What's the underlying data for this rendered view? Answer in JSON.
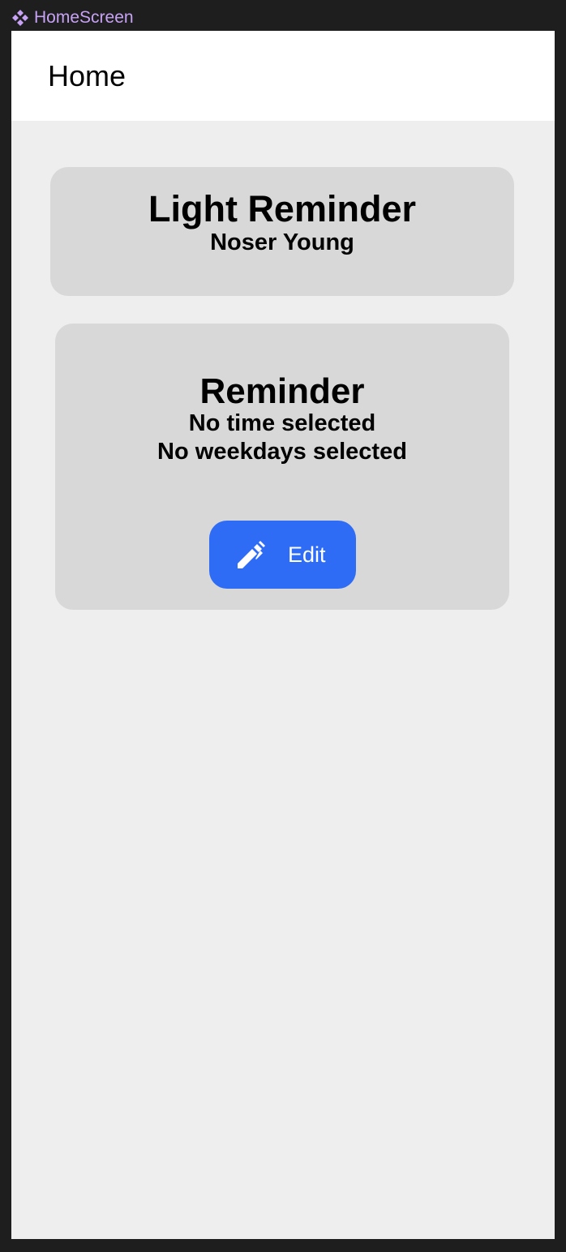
{
  "frame": {
    "label": "HomeScreen",
    "icon": "component-icon",
    "label_color": "#c7a2f5"
  },
  "appbar": {
    "title": "Home"
  },
  "header_card": {
    "title": "Light Reminder",
    "subtitle": "Noser Young"
  },
  "reminder_card": {
    "title": "Reminder",
    "time_text": "No time selected",
    "weekdays_text": "No weekdays selected",
    "edit_button": {
      "label": "Edit",
      "icon": "pencil-icon",
      "color": "#2f6cf6"
    }
  },
  "colors": {
    "background": "#eeeeee",
    "card": "#d8d8d8",
    "appbar": "#ffffff",
    "accent": "#2f6cf6"
  }
}
